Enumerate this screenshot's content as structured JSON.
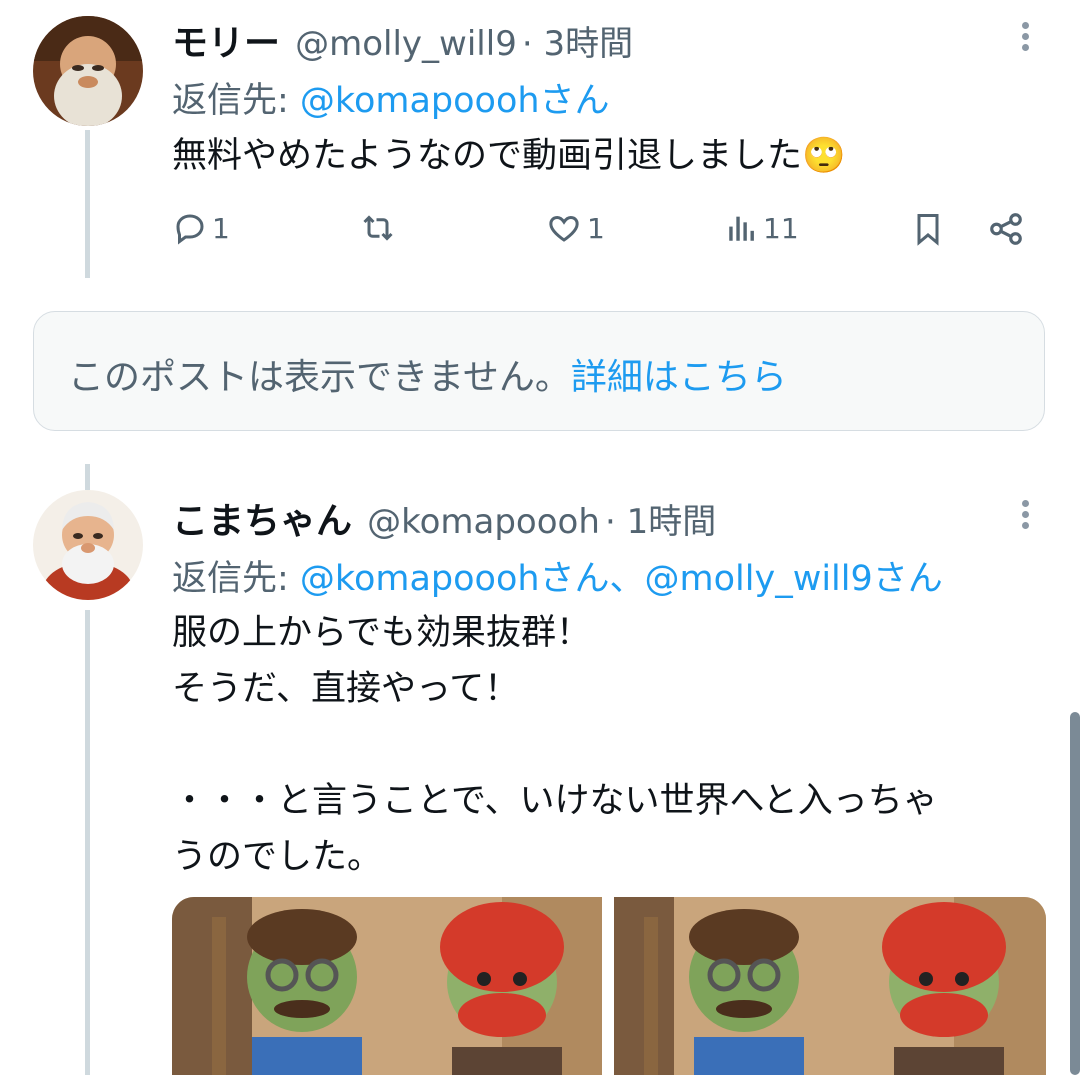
{
  "tweet1": {
    "display_name": "モリー",
    "handle": "@molly_will9",
    "time": "· 3時間",
    "reply_prefix": "返信先: ",
    "reply_to": "@komapooohさん",
    "text": "無料やめたようなので動画引退しました🙄",
    "actions": {
      "replies": "1",
      "reposts": "",
      "likes": "1",
      "views": "11"
    }
  },
  "unavailable_notice": {
    "text": "このポストは表示できません。",
    "link": "詳細はこちら"
  },
  "tweet2": {
    "display_name": "こまちゃん",
    "handle": "@komapoooh",
    "time": "· 1時間",
    "reply_prefix": "返信先: ",
    "reply_to": "@komapooohさん、@molly_will9さん",
    "text": "服の上からでも効果抜群！\nそうだ、直接やって！\n\n・・・と言うことで、いけない世界へと入っちゃ\nうのでした。"
  },
  "colors": {
    "accent": "#1d9bf0",
    "secondary_text": "#536471",
    "primary_text": "#0f1419",
    "thread_line": "#cfd9de"
  },
  "icons": [
    "more-icon",
    "reply-icon",
    "repost-icon",
    "like-icon",
    "views-icon",
    "bookmark-icon",
    "share-icon"
  ]
}
